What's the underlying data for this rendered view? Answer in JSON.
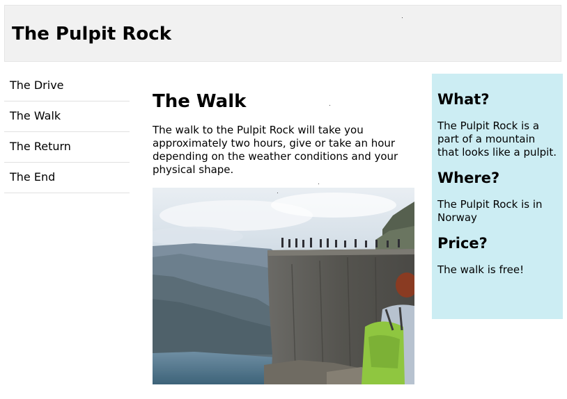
{
  "header": {
    "title": "The Pulpit Rock"
  },
  "menu": {
    "items": [
      {
        "label": "The Drive"
      },
      {
        "label": "The Walk"
      },
      {
        "label": "The Return"
      },
      {
        "label": "The End"
      }
    ]
  },
  "main": {
    "heading": "The Walk",
    "paragraph": "The walk to the Pulpit Rock will take you approximately two hours, give or take an hour depending on the weather conditions and your physical shape."
  },
  "aside": {
    "sections": [
      {
        "heading": "What?",
        "text": "The Pulpit Rock is a part of a mountain that looks like a pulpit."
      },
      {
        "heading": "Where?",
        "text": "The Pulpit Rock is in Norway"
      },
      {
        "heading": "Price?",
        "text": "The walk is free!"
      }
    ]
  },
  "colors": {
    "header_background": "#f1f1f1",
    "aside_background": "#ccedf3",
    "menu_divider": "#e0e0e0"
  }
}
